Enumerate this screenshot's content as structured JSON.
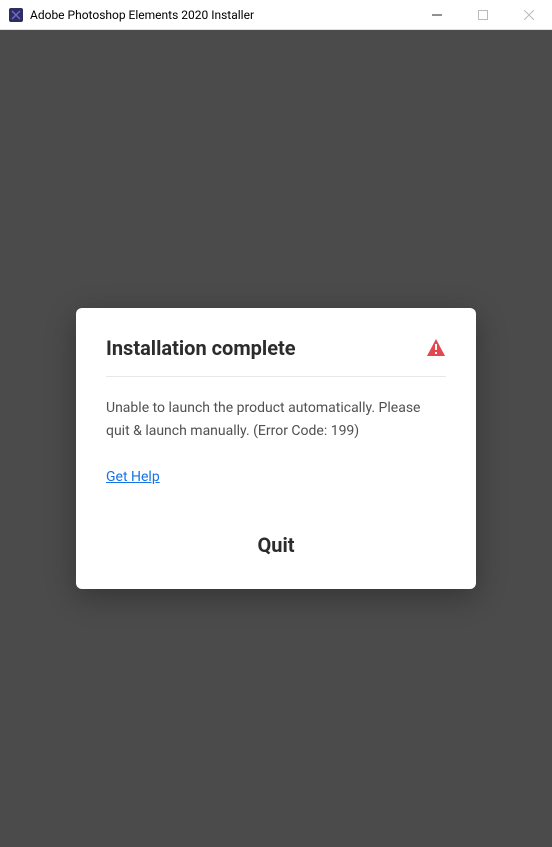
{
  "titlebar": {
    "title": "Adobe Photoshop Elements 2020 Installer"
  },
  "dialog": {
    "title": "Installation complete",
    "message": "Unable to launch the product automatically. Please quit & launch manually. (Error Code: 199)",
    "help_label": "Get Help",
    "quit_label": "Quit"
  },
  "colors": {
    "warning": "#e34850",
    "link": "#1473e6"
  }
}
